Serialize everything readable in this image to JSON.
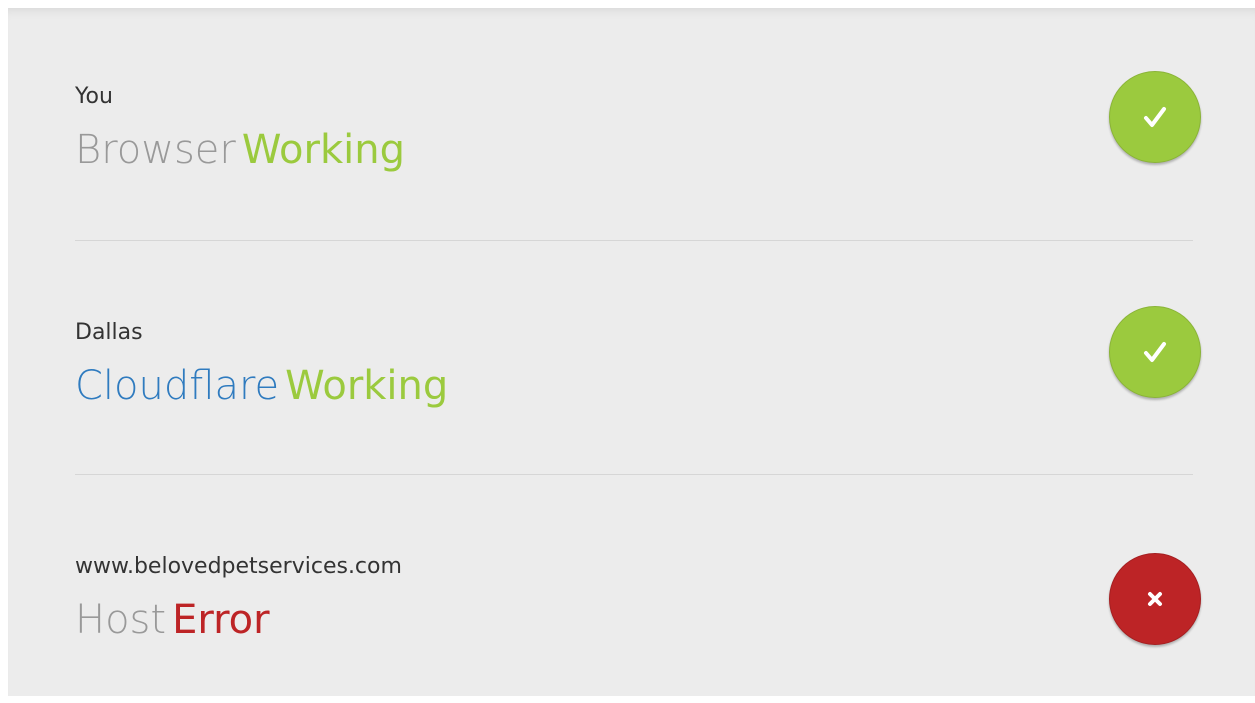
{
  "rows": [
    {
      "location": "You",
      "name": "Browser",
      "status": "Working",
      "status_type": "ok",
      "icon": "check-icon"
    },
    {
      "location": "Dallas",
      "name": "Cloudflare",
      "status": "Working",
      "status_type": "ok",
      "icon": "check-icon"
    },
    {
      "location": "www.belovedpetservices.com",
      "name": "Host",
      "status": "Error",
      "status_type": "error",
      "icon": "error-x-icon"
    }
  ],
  "colors": {
    "panel_bg": "#ececec",
    "ok_green": "#9bca3e",
    "error_red": "#bd2426",
    "cloudflare_blue": "#2f7bbf",
    "muted_gray": "#999999"
  }
}
